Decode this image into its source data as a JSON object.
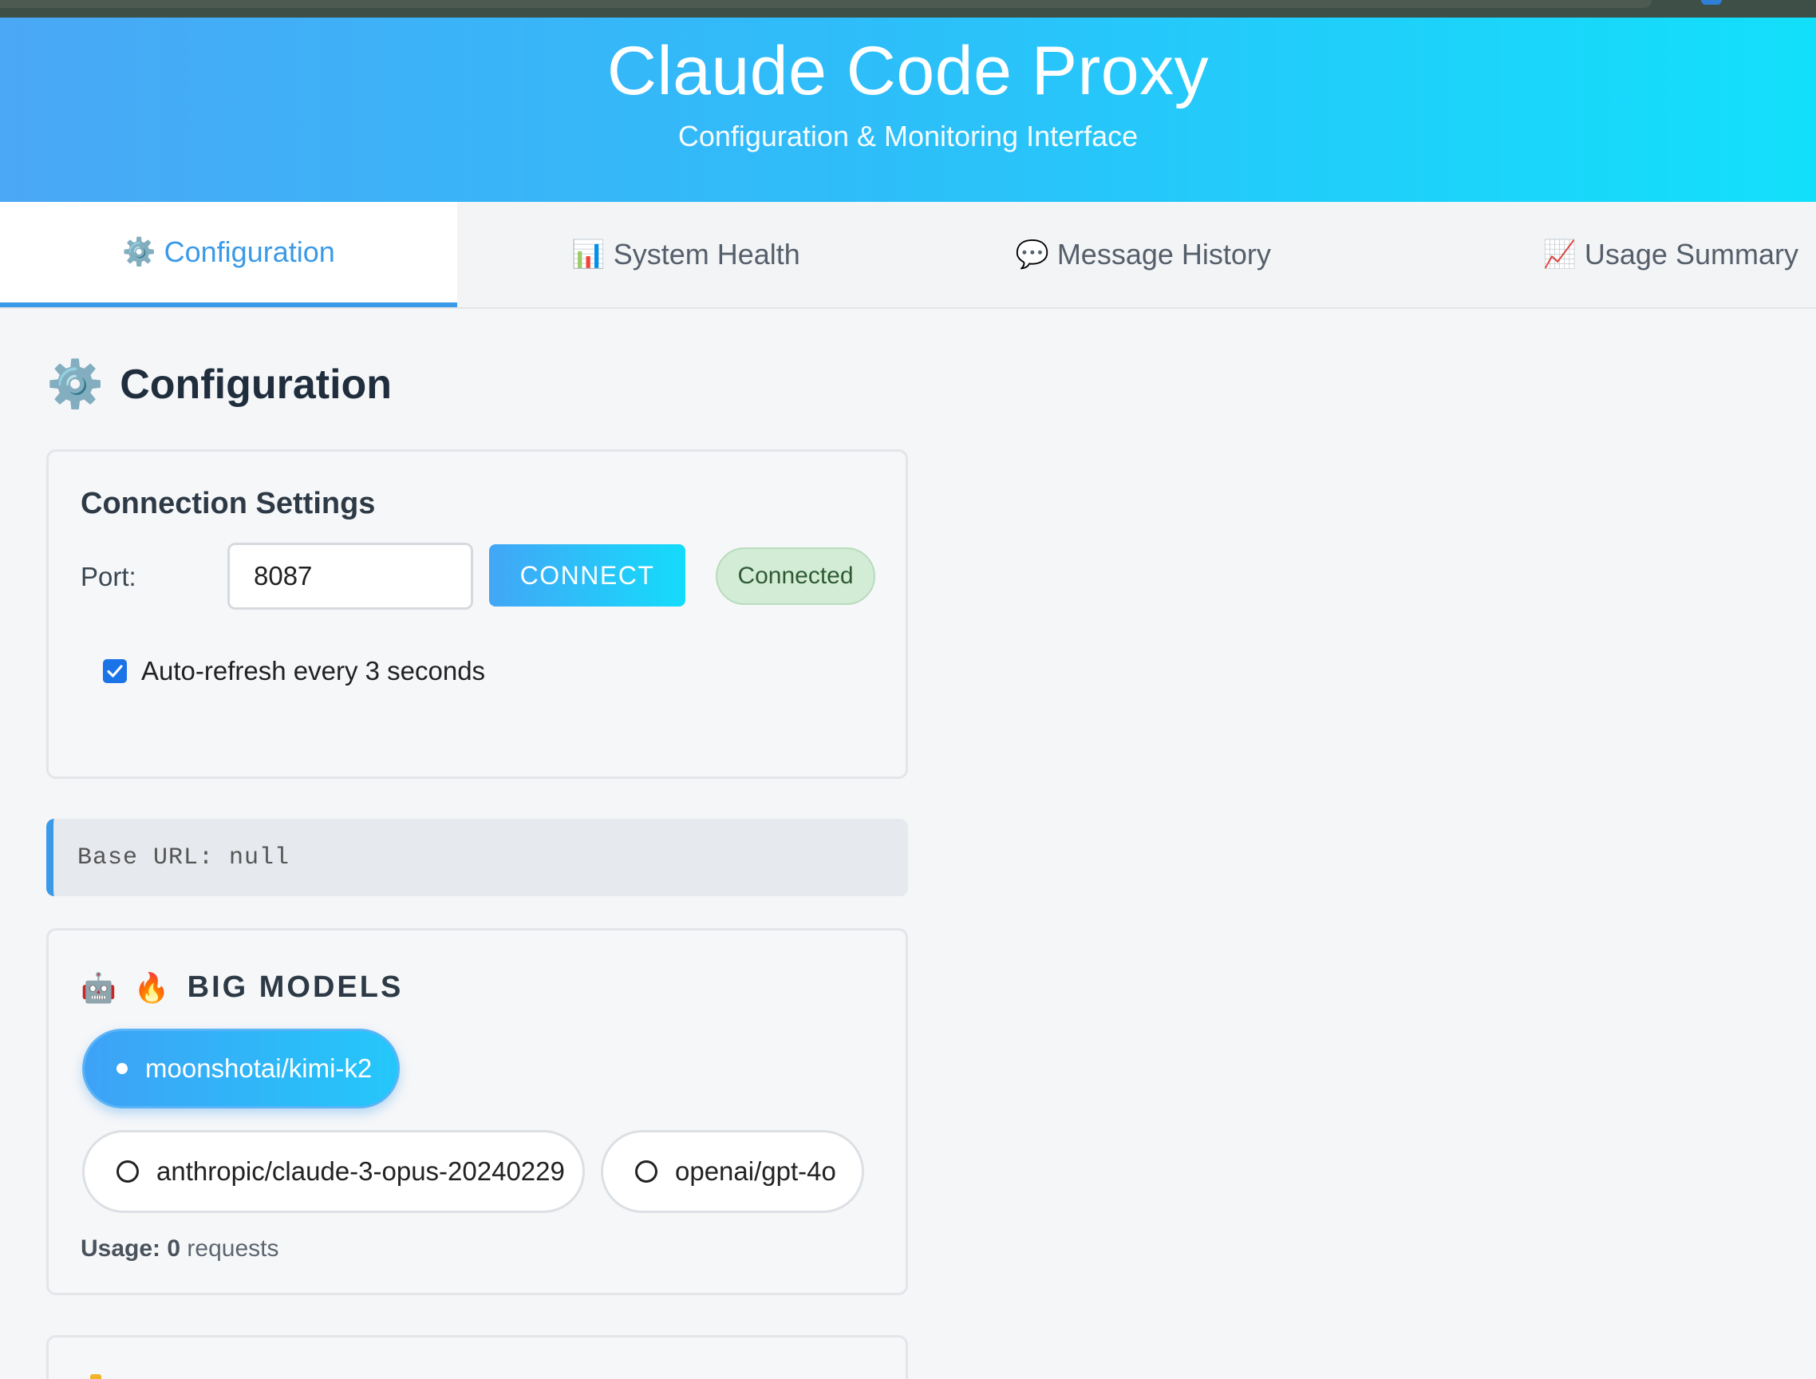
{
  "header": {
    "title": "Claude Code Proxy",
    "subtitle": "Configuration & Monitoring Interface"
  },
  "tabs": [
    {
      "icon": "⚙️",
      "label": "Configuration",
      "active": true
    },
    {
      "icon": "📊",
      "label": "System Health",
      "active": false
    },
    {
      "icon": "💬",
      "label": "Message History",
      "active": false
    },
    {
      "icon": "📈",
      "label": "Usage Summary",
      "active": false
    }
  ],
  "section": {
    "icon": "⚙️",
    "title": "Configuration"
  },
  "connection": {
    "heading": "Connection Settings",
    "port_label": "Port:",
    "port_value": "8087",
    "connect_label": "CONNECT",
    "status": "Connected",
    "status_color": "#d3ecd6",
    "auto_refresh_label": "Auto-refresh every 3 seconds",
    "auto_refresh_checked": true
  },
  "base_url": "Base URL: null",
  "big_models": {
    "icon1": "🤖",
    "icon2": "🔥",
    "heading": "BIG MODELS",
    "selected": "moonshotai/kimi-k2",
    "options": [
      "anthropic/claude-3-opus-20240229",
      "openai/gpt-4o"
    ],
    "usage_label": "Usage:",
    "usage_count": "0",
    "usage_unit": "requests"
  },
  "colors": {
    "accent": "#3a9ae8",
    "header_start": "#4aa8f6",
    "header_end": "#12e0fb"
  }
}
